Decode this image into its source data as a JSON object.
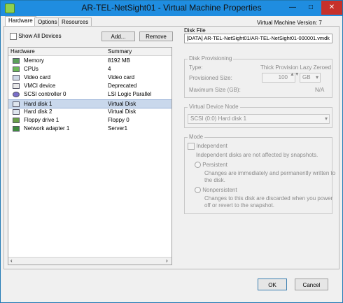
{
  "window": {
    "title": "AR-TEL-NetSight01 - Virtual Machine Properties",
    "minimize_glyph": "—",
    "maximize_glyph": "□",
    "close_glyph": "✕"
  },
  "tabs": [
    {
      "label": "Hardware"
    },
    {
      "label": "Options"
    },
    {
      "label": "Resources"
    }
  ],
  "vm_version": "Virtual Machine Version: 7",
  "hardware": {
    "show_all_devices": "Show All Devices",
    "add_label": "Add...",
    "remove_label": "Remove",
    "col_hardware": "Hardware",
    "col_summary": "Summary",
    "rows": [
      {
        "name": "Memory",
        "summary": "8192 MB",
        "icon": "memory-icon"
      },
      {
        "name": "CPUs",
        "summary": "4",
        "icon": "cpu-icon"
      },
      {
        "name": "Video card",
        "summary": "Video card",
        "icon": "video-card-icon"
      },
      {
        "name": "VMCI device",
        "summary": "Deprecated",
        "icon": "vmci-icon"
      },
      {
        "name": "SCSI controller 0",
        "summary": "LSI Logic Parallel",
        "icon": "scsi-controller-icon"
      },
      {
        "name": "Hard disk 1",
        "summary": "Virtual Disk",
        "icon": "hard-disk-icon",
        "selected": true
      },
      {
        "name": "Hard disk 2",
        "summary": "Virtual Disk",
        "icon": "hard-disk-icon"
      },
      {
        "name": "Floppy drive 1",
        "summary": "Floppy 0",
        "icon": "floppy-icon"
      },
      {
        "name": "Network adapter 1",
        "summary": "Server1",
        "icon": "network-adapter-icon"
      }
    ],
    "scroll_left_glyph": "‹",
    "scroll_right_glyph": "›"
  },
  "disk_file": {
    "label": "Disk File",
    "value": "[DATA] AR-TEL-NetSight01/AR-TEL-NetSight01-000001.vmdk"
  },
  "disk_provisioning": {
    "label": "Disk Provisioning",
    "type_label": "Type:",
    "type_value": "Thick Provision Lazy Zeroed",
    "provisioned_label": "Provisioned Size:",
    "provisioned_value": "100",
    "unit": "GB",
    "max_label": "Maximum Size (GB):",
    "max_value": "N/A"
  },
  "virtual_device_node": {
    "label": "Virtual Device Node",
    "value": "SCSI (0:0) Hard disk 1"
  },
  "mode": {
    "label": "Mode",
    "independent_label": "Independent",
    "independent_desc": "Independent disks are not affected by snapshots.",
    "persistent_label": "Persistent",
    "persistent_desc1": "Changes are immediately and permanently written to",
    "persistent_desc2": "the disk.",
    "nonpersistent_label": "Nonpersistent",
    "nonpersistent_desc1": "Changes to this disk are discarded when you power",
    "nonpersistent_desc2": "off or revert to the snapshot."
  },
  "footer": {
    "ok_label": "OK",
    "cancel_label": "Cancel"
  },
  "colors": {
    "titlebar": "#1f8de0",
    "close": "#c7312b",
    "selection": "#c9d8ec"
  }
}
